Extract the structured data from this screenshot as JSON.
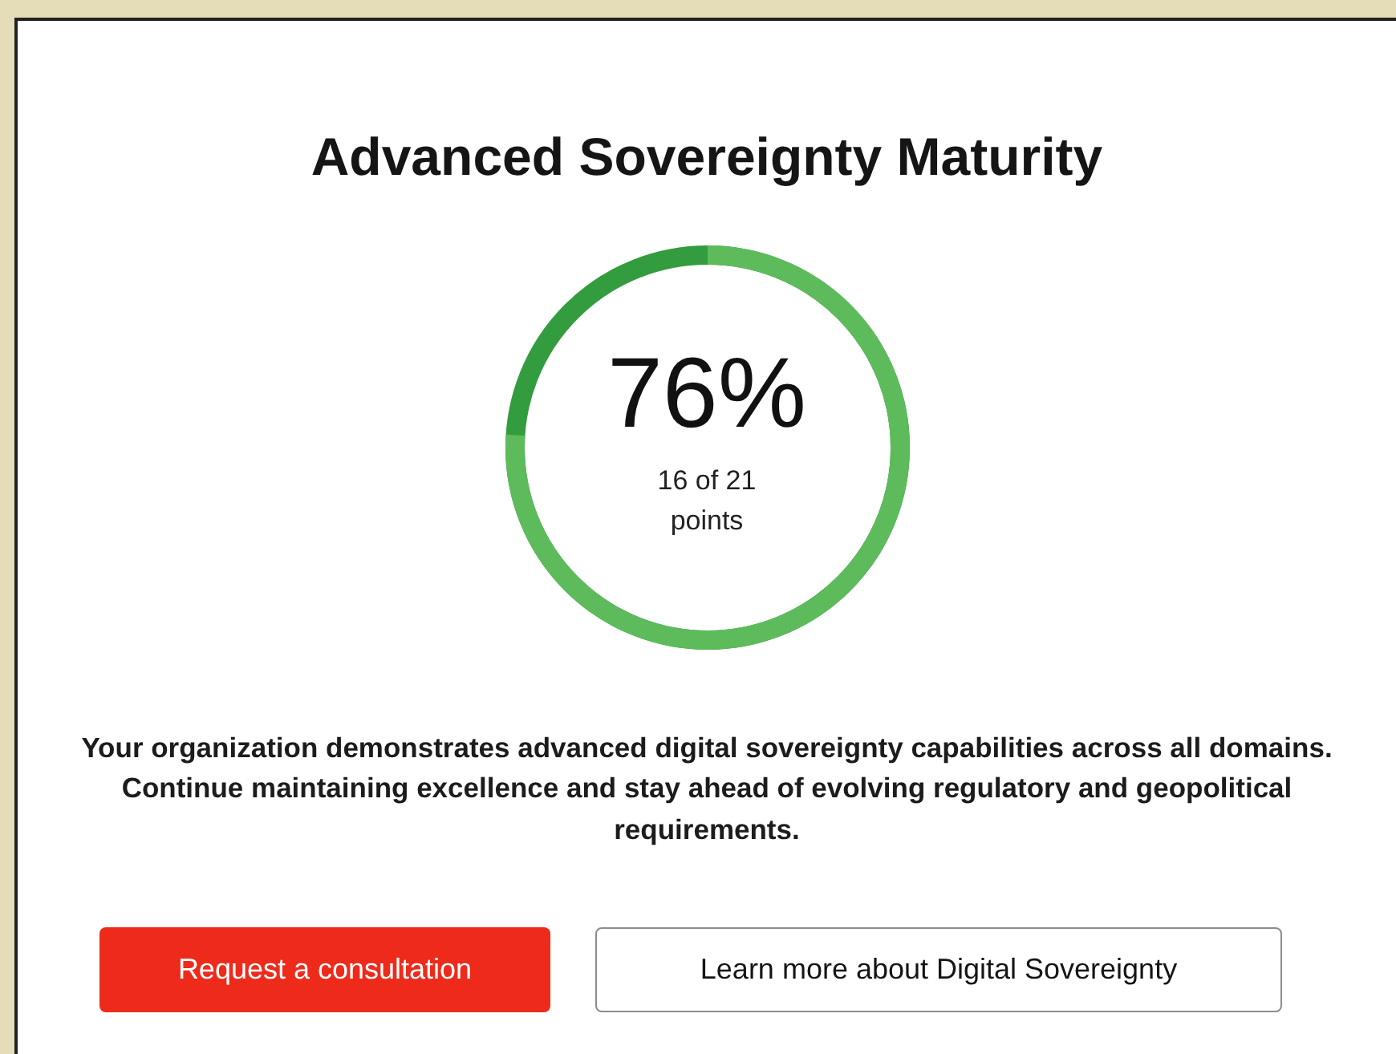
{
  "title": "Advanced Sovereignty Maturity",
  "score": {
    "percent": "76%",
    "points": "16 of 21 points",
    "level": 0.76
  },
  "message": "Your organization demonstrates advanced digital sovereignty capabilities across all domains. Continue maintaining excellence and stay ahead of evolving regulatory and geopolitical requirements.",
  "buttons": [
    {
      "label": "Request a consultation",
      "kind": "primary"
    },
    {
      "label": "Learn more about Digital Sovereignty",
      "kind": "secondary"
    }
  ]
}
